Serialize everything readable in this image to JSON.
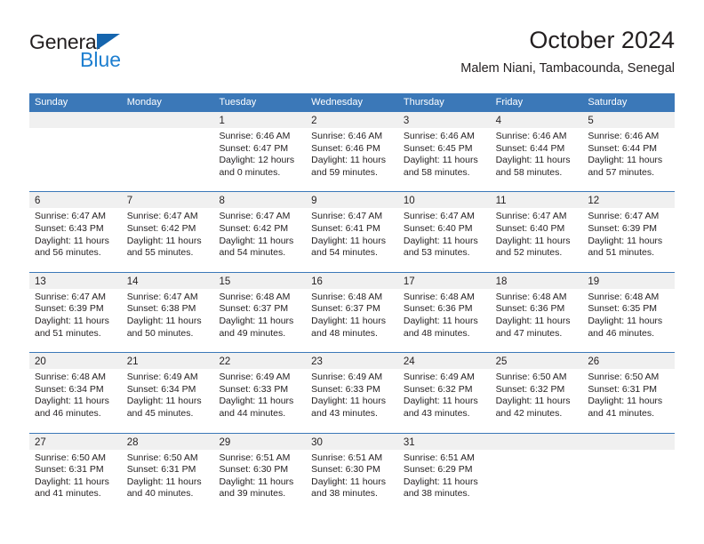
{
  "brand": {
    "name_part1": "General",
    "name_part2": "Blue",
    "triangle_color": "#1565ae",
    "blue_color": "#1e7fd0"
  },
  "header": {
    "title": "October 2024",
    "subtitle": "Malem Niani, Tambacounda, Senegal"
  },
  "theme": {
    "header_blue": "#3b78b8",
    "daynum_band": "#f0f0f0",
    "text": "#231f20"
  },
  "calendar": {
    "day_headers": [
      "Sunday",
      "Monday",
      "Tuesday",
      "Wednesday",
      "Thursday",
      "Friday",
      "Saturday"
    ],
    "weeks": [
      [
        {
          "day": "",
          "empty": true,
          "sunrise": "",
          "sunset": "",
          "daylight_line1": "",
          "daylight_line2": ""
        },
        {
          "day": "",
          "empty": true,
          "sunrise": "",
          "sunset": "",
          "daylight_line1": "",
          "daylight_line2": ""
        },
        {
          "day": "1",
          "sunrise": "Sunrise: 6:46 AM",
          "sunset": "Sunset: 6:47 PM",
          "daylight_line1": "Daylight: 12 hours",
          "daylight_line2": "and 0 minutes."
        },
        {
          "day": "2",
          "sunrise": "Sunrise: 6:46 AM",
          "sunset": "Sunset: 6:46 PM",
          "daylight_line1": "Daylight: 11 hours",
          "daylight_line2": "and 59 minutes."
        },
        {
          "day": "3",
          "sunrise": "Sunrise: 6:46 AM",
          "sunset": "Sunset: 6:45 PM",
          "daylight_line1": "Daylight: 11 hours",
          "daylight_line2": "and 58 minutes."
        },
        {
          "day": "4",
          "sunrise": "Sunrise: 6:46 AM",
          "sunset": "Sunset: 6:44 PM",
          "daylight_line1": "Daylight: 11 hours",
          "daylight_line2": "and 58 minutes."
        },
        {
          "day": "5",
          "sunrise": "Sunrise: 6:46 AM",
          "sunset": "Sunset: 6:44 PM",
          "daylight_line1": "Daylight: 11 hours",
          "daylight_line2": "and 57 minutes."
        }
      ],
      [
        {
          "day": "6",
          "sunrise": "Sunrise: 6:47 AM",
          "sunset": "Sunset: 6:43 PM",
          "daylight_line1": "Daylight: 11 hours",
          "daylight_line2": "and 56 minutes."
        },
        {
          "day": "7",
          "sunrise": "Sunrise: 6:47 AM",
          "sunset": "Sunset: 6:42 PM",
          "daylight_line1": "Daylight: 11 hours",
          "daylight_line2": "and 55 minutes."
        },
        {
          "day": "8",
          "sunrise": "Sunrise: 6:47 AM",
          "sunset": "Sunset: 6:42 PM",
          "daylight_line1": "Daylight: 11 hours",
          "daylight_line2": "and 54 minutes."
        },
        {
          "day": "9",
          "sunrise": "Sunrise: 6:47 AM",
          "sunset": "Sunset: 6:41 PM",
          "daylight_line1": "Daylight: 11 hours",
          "daylight_line2": "and 54 minutes."
        },
        {
          "day": "10",
          "sunrise": "Sunrise: 6:47 AM",
          "sunset": "Sunset: 6:40 PM",
          "daylight_line1": "Daylight: 11 hours",
          "daylight_line2": "and 53 minutes."
        },
        {
          "day": "11",
          "sunrise": "Sunrise: 6:47 AM",
          "sunset": "Sunset: 6:40 PM",
          "daylight_line1": "Daylight: 11 hours",
          "daylight_line2": "and 52 minutes."
        },
        {
          "day": "12",
          "sunrise": "Sunrise: 6:47 AM",
          "sunset": "Sunset: 6:39 PM",
          "daylight_line1": "Daylight: 11 hours",
          "daylight_line2": "and 51 minutes."
        }
      ],
      [
        {
          "day": "13",
          "sunrise": "Sunrise: 6:47 AM",
          "sunset": "Sunset: 6:39 PM",
          "daylight_line1": "Daylight: 11 hours",
          "daylight_line2": "and 51 minutes."
        },
        {
          "day": "14",
          "sunrise": "Sunrise: 6:47 AM",
          "sunset": "Sunset: 6:38 PM",
          "daylight_line1": "Daylight: 11 hours",
          "daylight_line2": "and 50 minutes."
        },
        {
          "day": "15",
          "sunrise": "Sunrise: 6:48 AM",
          "sunset": "Sunset: 6:37 PM",
          "daylight_line1": "Daylight: 11 hours",
          "daylight_line2": "and 49 minutes."
        },
        {
          "day": "16",
          "sunrise": "Sunrise: 6:48 AM",
          "sunset": "Sunset: 6:37 PM",
          "daylight_line1": "Daylight: 11 hours",
          "daylight_line2": "and 48 minutes."
        },
        {
          "day": "17",
          "sunrise": "Sunrise: 6:48 AM",
          "sunset": "Sunset: 6:36 PM",
          "daylight_line1": "Daylight: 11 hours",
          "daylight_line2": "and 48 minutes."
        },
        {
          "day": "18",
          "sunrise": "Sunrise: 6:48 AM",
          "sunset": "Sunset: 6:36 PM",
          "daylight_line1": "Daylight: 11 hours",
          "daylight_line2": "and 47 minutes."
        },
        {
          "day": "19",
          "sunrise": "Sunrise: 6:48 AM",
          "sunset": "Sunset: 6:35 PM",
          "daylight_line1": "Daylight: 11 hours",
          "daylight_line2": "and 46 minutes."
        }
      ],
      [
        {
          "day": "20",
          "sunrise": "Sunrise: 6:48 AM",
          "sunset": "Sunset: 6:34 PM",
          "daylight_line1": "Daylight: 11 hours",
          "daylight_line2": "and 46 minutes."
        },
        {
          "day": "21",
          "sunrise": "Sunrise: 6:49 AM",
          "sunset": "Sunset: 6:34 PM",
          "daylight_line1": "Daylight: 11 hours",
          "daylight_line2": "and 45 minutes."
        },
        {
          "day": "22",
          "sunrise": "Sunrise: 6:49 AM",
          "sunset": "Sunset: 6:33 PM",
          "daylight_line1": "Daylight: 11 hours",
          "daylight_line2": "and 44 minutes."
        },
        {
          "day": "23",
          "sunrise": "Sunrise: 6:49 AM",
          "sunset": "Sunset: 6:33 PM",
          "daylight_line1": "Daylight: 11 hours",
          "daylight_line2": "and 43 minutes."
        },
        {
          "day": "24",
          "sunrise": "Sunrise: 6:49 AM",
          "sunset": "Sunset: 6:32 PM",
          "daylight_line1": "Daylight: 11 hours",
          "daylight_line2": "and 43 minutes."
        },
        {
          "day": "25",
          "sunrise": "Sunrise: 6:50 AM",
          "sunset": "Sunset: 6:32 PM",
          "daylight_line1": "Daylight: 11 hours",
          "daylight_line2": "and 42 minutes."
        },
        {
          "day": "26",
          "sunrise": "Sunrise: 6:50 AM",
          "sunset": "Sunset: 6:31 PM",
          "daylight_line1": "Daylight: 11 hours",
          "daylight_line2": "and 41 minutes."
        }
      ],
      [
        {
          "day": "27",
          "sunrise": "Sunrise: 6:50 AM",
          "sunset": "Sunset: 6:31 PM",
          "daylight_line1": "Daylight: 11 hours",
          "daylight_line2": "and 41 minutes."
        },
        {
          "day": "28",
          "sunrise": "Sunrise: 6:50 AM",
          "sunset": "Sunset: 6:31 PM",
          "daylight_line1": "Daylight: 11 hours",
          "daylight_line2": "and 40 minutes."
        },
        {
          "day": "29",
          "sunrise": "Sunrise: 6:51 AM",
          "sunset": "Sunset: 6:30 PM",
          "daylight_line1": "Daylight: 11 hours",
          "daylight_line2": "and 39 minutes."
        },
        {
          "day": "30",
          "sunrise": "Sunrise: 6:51 AM",
          "sunset": "Sunset: 6:30 PM",
          "daylight_line1": "Daylight: 11 hours",
          "daylight_line2": "and 38 minutes."
        },
        {
          "day": "31",
          "sunrise": "Sunrise: 6:51 AM",
          "sunset": "Sunset: 6:29 PM",
          "daylight_line1": "Daylight: 11 hours",
          "daylight_line2": "and 38 minutes."
        },
        {
          "day": "",
          "empty": true,
          "sunrise": "",
          "sunset": "",
          "daylight_line1": "",
          "daylight_line2": ""
        },
        {
          "day": "",
          "empty": true,
          "sunrise": "",
          "sunset": "",
          "daylight_line1": "",
          "daylight_line2": ""
        }
      ]
    ]
  }
}
